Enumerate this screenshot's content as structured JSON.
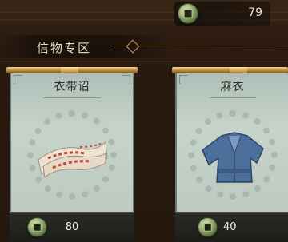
{
  "currency": {
    "icon": "copper-coin-icon",
    "amount": "79"
  },
  "section": {
    "title": "信物专区"
  },
  "items": [
    {
      "name": "衣带诏",
      "price": "80",
      "price_icon": "copper-coin-icon",
      "art": "scroll-bundle-icon"
    },
    {
      "name": "麻衣",
      "price": "40",
      "price_icon": "copper-coin-icon",
      "art": "blue-robe-icon"
    }
  ],
  "colors": {
    "card_bg": "#c6d3cb",
    "gold_rod": "#d8b262",
    "footer_bg": "#1f1f1c",
    "robe_blue": "#4d6f9c",
    "scroll_red": "#c2473a"
  }
}
